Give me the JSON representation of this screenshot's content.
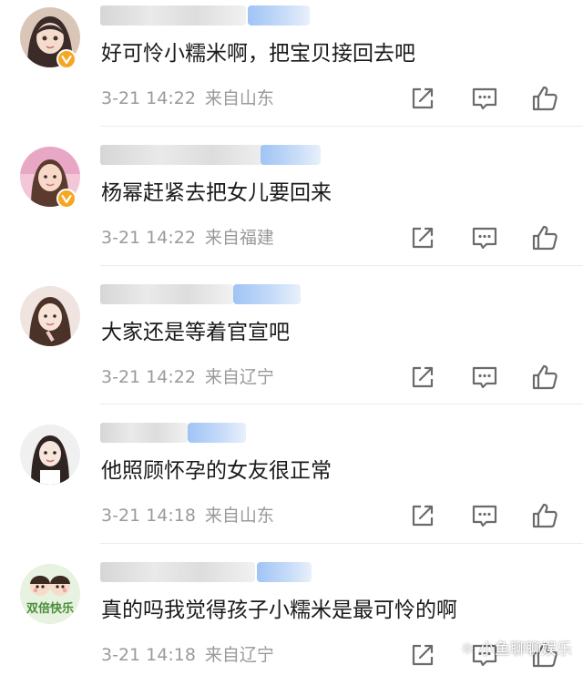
{
  "comments": [
    {
      "text": "好可怜小糯米啊，把宝贝接回去吧",
      "time": "3-21 14:22",
      "location": "来自山东",
      "avatar_icon": "avatar-anime-girl-icon",
      "verified": true
    },
    {
      "text": "杨幂赶紧去把女儿要回来",
      "time": "3-21 14:22",
      "location": "来自福建",
      "avatar_icon": "avatar-girl-photo-icon",
      "verified": true
    },
    {
      "text": "大家还是等着官宣吧",
      "time": "3-21 14:22",
      "location": "来自辽宁",
      "avatar_icon": "avatar-girl-photo-icon",
      "verified": false
    },
    {
      "text": "他照顾怀孕的女友很正常",
      "time": "3-21 14:18",
      "location": "来自山东",
      "avatar_icon": "avatar-girl-photo-icon",
      "verified": false
    },
    {
      "text": "真的吗我觉得孩子小糯米是最可怜的啊",
      "time": "3-21 14:18",
      "location": "来自辽宁",
      "avatar_icon": "avatar-cartoon-couple-icon",
      "avatar_caption": "双倍快乐",
      "verified": false
    }
  ],
  "actions": {
    "share_icon": "share-icon",
    "comment_icon": "comment-icon",
    "like_icon": "thumbs-up-icon"
  },
  "watermark": "小鱼聊聊娱乐",
  "colors": {
    "text": "#1a1a1a",
    "meta": "#9a9a9a",
    "icon": "#6b6b6b",
    "verified_badge": "#f5a623",
    "blurred_badge": "#9fc4f5"
  }
}
